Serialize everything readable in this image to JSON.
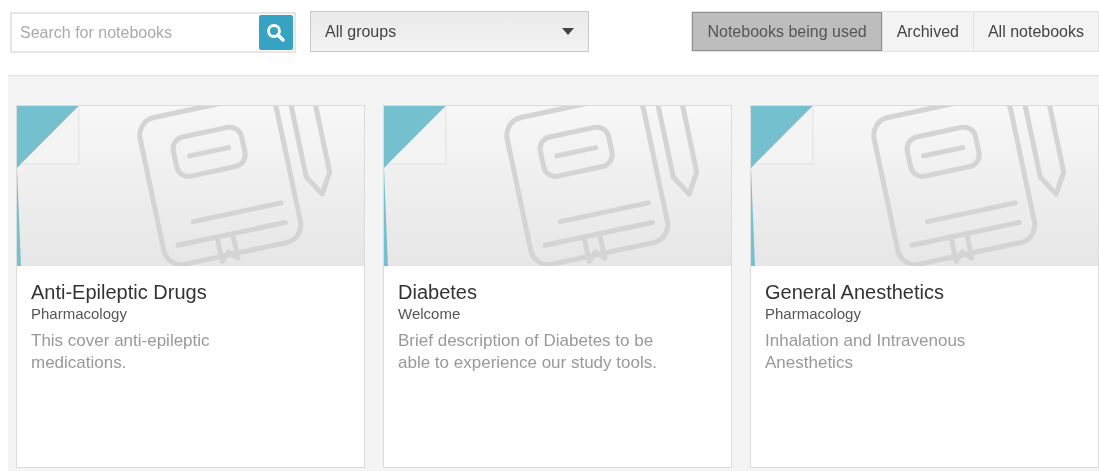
{
  "search": {
    "placeholder": "Search for notebooks"
  },
  "group_filter": {
    "value": "All groups"
  },
  "filters": [
    {
      "label": "Notebooks being used",
      "selected": true
    },
    {
      "label": "Archived",
      "selected": false
    },
    {
      "label": "All notebooks",
      "selected": false
    }
  ],
  "notebooks": [
    {
      "title": "Anti-Epileptic Drugs",
      "group": "Pharmacology",
      "description": "This cover anti-epileptic medications."
    },
    {
      "title": "Diabetes",
      "group": "Welcome",
      "description": "Brief description of Diabetes to be able to experience our study tools."
    },
    {
      "title": "General Anesthetics",
      "group": "Pharmacology",
      "description": "Inhalation and Intravenous Anesthetics"
    }
  ]
}
